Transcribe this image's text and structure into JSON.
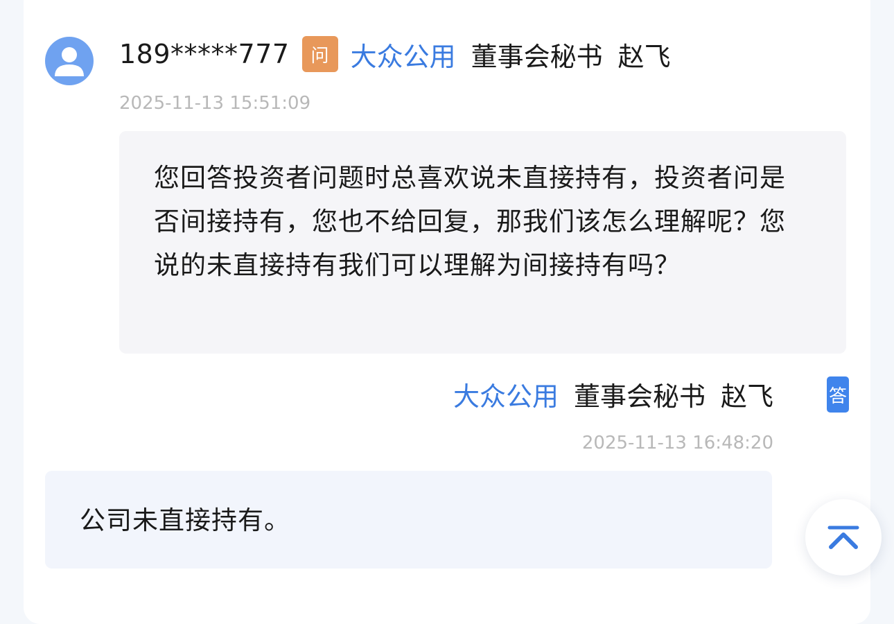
{
  "question": {
    "user_id": "189*****777",
    "badge": "问",
    "company": "大众公用",
    "role": "董事会秘书",
    "person": "赵飞",
    "timestamp": "2025-11-13 15:51:09",
    "text": "您回答投资者问题时总喜欢说未直接持有，投资者问是否间接持有，您也不给回复，那我们该怎么理解呢？您说的未直接持有我们可以理解为间接持有吗？"
  },
  "answer": {
    "company": "大众公用",
    "role": "董事会秘书",
    "person": "赵飞",
    "badge": "答",
    "timestamp": "2025-11-13 16:48:20",
    "text": "公司未直接持有。"
  },
  "icons": {
    "avatar": "user-avatar-icon",
    "scroll_top": "back-to-top-icon"
  },
  "colors": {
    "accent_blue": "#3a7be0",
    "ask_badge": "#e8985a",
    "answer_badge": "#3f84ec",
    "avatar": "#6fa2f0"
  }
}
